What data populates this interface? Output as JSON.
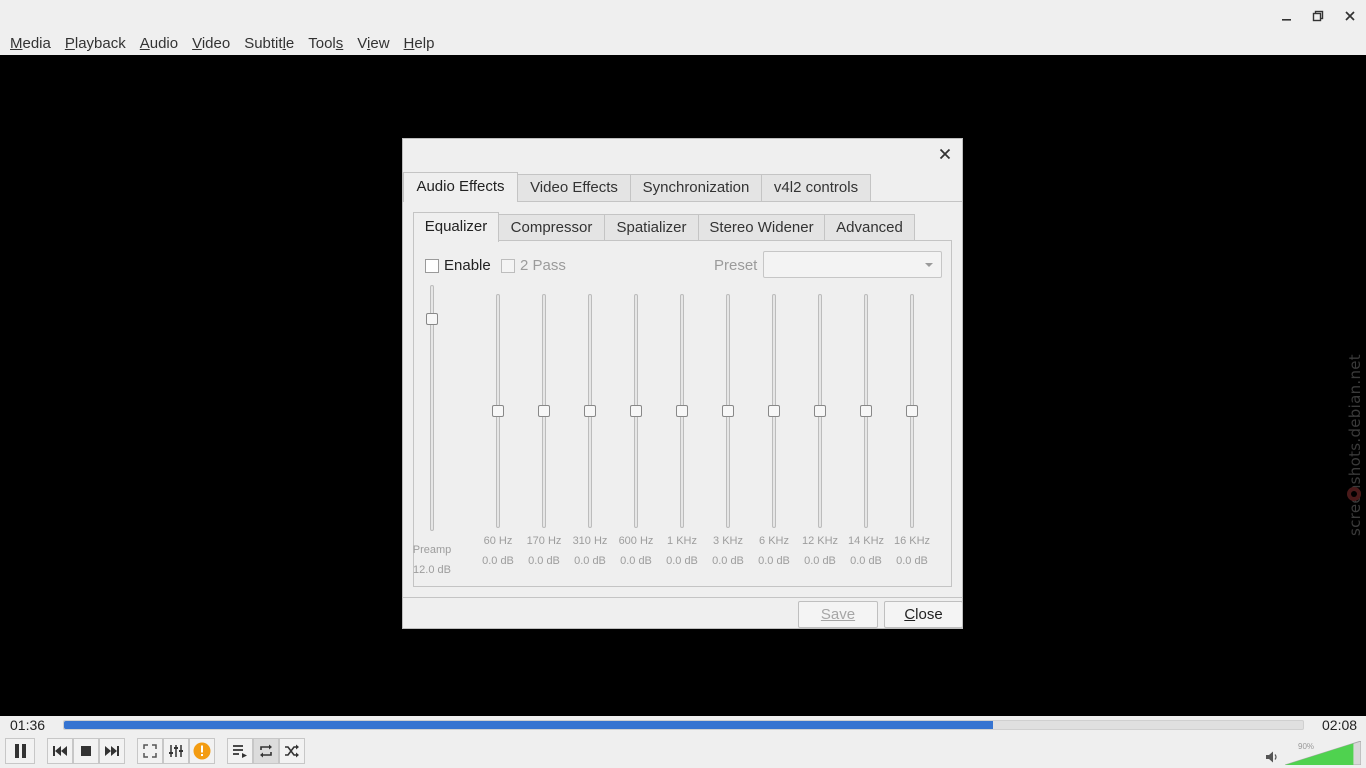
{
  "menubar": {
    "items": [
      {
        "pre": "",
        "u": "M",
        "post": "edia"
      },
      {
        "pre": "",
        "u": "P",
        "post": "layback"
      },
      {
        "pre": "",
        "u": "A",
        "post": "udio"
      },
      {
        "pre": "",
        "u": "V",
        "post": "ideo"
      },
      {
        "pre": "Subtit",
        "u": "l",
        "post": "e"
      },
      {
        "pre": "Tool",
        "u": "s",
        "post": ""
      },
      {
        "pre": "V",
        "u": "i",
        "post": "ew"
      },
      {
        "pre": "",
        "u": "H",
        "post": "elp"
      }
    ]
  },
  "watermark": "screenshots.debian.net",
  "dialog": {
    "tabs": [
      "Audio Effects",
      "Video Effects",
      "Synchronization",
      "v4l2 controls"
    ],
    "active_tab": "Audio Effects",
    "subtabs": [
      "Equalizer",
      "Compressor",
      "Spatializer",
      "Stereo Widener",
      "Advanced"
    ],
    "active_subtab": "Equalizer",
    "enable_label": "Enable",
    "enable_checked": false,
    "two_pass_label": "2 Pass",
    "two_pass_checked": false,
    "preset_label": "Preset",
    "preset_value": "",
    "preamp": {
      "label": "Preamp",
      "value": "12.0 dB",
      "level": 0.86
    },
    "bands": [
      {
        "freq": "60 Hz",
        "value": "0.0 dB"
      },
      {
        "freq": "170 Hz",
        "value": "0.0 dB"
      },
      {
        "freq": "310 Hz",
        "value": "0.0 dB"
      },
      {
        "freq": "600 Hz",
        "value": "0.0 dB"
      },
      {
        "freq": "1 KHz",
        "value": "0.0 dB"
      },
      {
        "freq": "3 KHz",
        "value": "0.0 dB"
      },
      {
        "freq": "6 KHz",
        "value": "0.0 dB"
      },
      {
        "freq": "12 KHz",
        "value": "0.0 dB"
      },
      {
        "freq": "14 KHz",
        "value": "0.0 dB"
      },
      {
        "freq": "16 KHz",
        "value": "0.0 dB"
      }
    ],
    "save_label": "Save",
    "close_label_u": "C",
    "close_label_rest": "lose"
  },
  "player": {
    "elapsed": "01:36",
    "total": "02:08",
    "progress": 0.75,
    "volume_label": "90%",
    "volume": 0.9
  },
  "colors": {
    "accent": "#3674d1",
    "volume_green": "#4fd24f",
    "info_orange": "#f39c12"
  }
}
